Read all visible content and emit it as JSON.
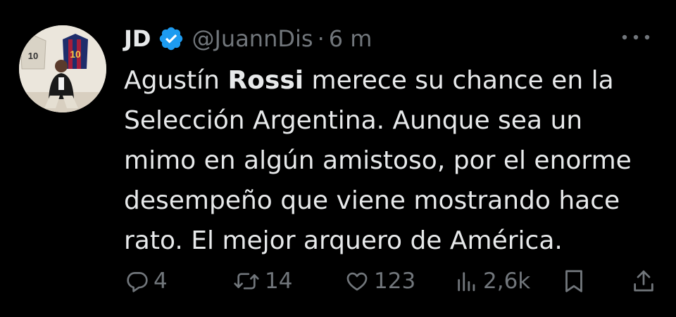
{
  "author": {
    "name": "JD",
    "handle": "@JuannDis",
    "separator": "·",
    "time": "6 m"
  },
  "avatar": {
    "jersey_numbers": [
      "10",
      "10"
    ]
  },
  "tweet": {
    "before_bold": "Agustín ",
    "bold": "Rossi",
    "after_bold": " merece su chance en la Selección Argentina. Aunque sea un mimo en algún amistoso, por el enorme desempeño que viene mostrando hace rato. El mejor arquero de América."
  },
  "actions": {
    "replies": "4",
    "retweets": "14",
    "likes": "123",
    "views": "2,6k"
  },
  "colors": {
    "background": "#000000",
    "text": "#e7e9ea",
    "muted": "#71767b",
    "verified": "#1d9bf0"
  },
  "icons": [
    "verified-badge-icon",
    "more-icon",
    "reply-icon",
    "retweet-icon",
    "like-icon",
    "views-icon",
    "bookmark-icon",
    "share-icon"
  ]
}
